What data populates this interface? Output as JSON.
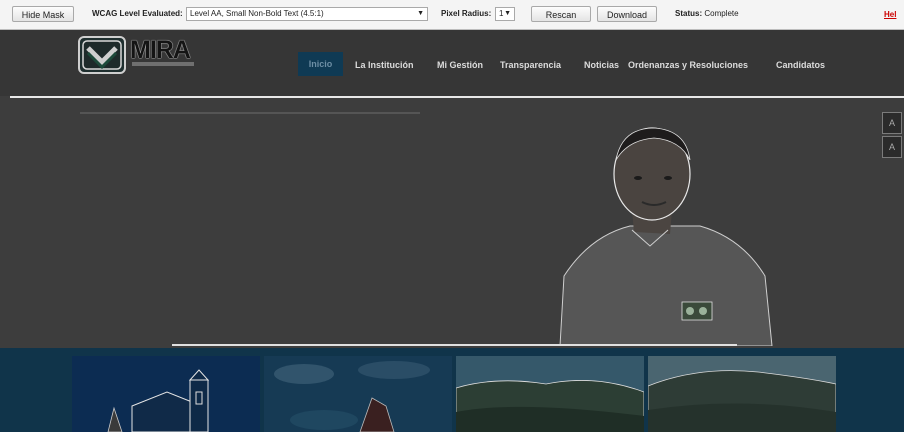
{
  "toolbar": {
    "hide_mask_label": "Hide Mask",
    "wcag_label": "WCAG Level Evaluated:",
    "wcag_selected": "Level AA, Small Non-Bold Text (4.5:1)",
    "pixel_radius_label": "Pixel Radius:",
    "pixel_radius_selected": "1",
    "rescan_label": "Rescan",
    "download_label": "Download",
    "status_label": "Status:",
    "status_value": "Complete",
    "help_label": "Hel"
  },
  "site": {
    "logo_text": "MIRA",
    "nav": [
      {
        "label": "Inicio",
        "active": true
      },
      {
        "label": "La Institución"
      },
      {
        "label": "Mi Gestión"
      },
      {
        "label": "Transparencia"
      },
      {
        "label": "Noticias"
      },
      {
        "label": "Ordenanzas y Resoluciones"
      },
      {
        "label": "Candidatos"
      }
    ]
  },
  "side_buttons": [
    "A",
    "A"
  ],
  "colors": {
    "toolbar_bg": "#f4f4f4",
    "header_bg": "#363636",
    "active_nav_bg": "#0f3a54",
    "gallery_bg": "#10344a",
    "help_link": "#cc0000"
  }
}
